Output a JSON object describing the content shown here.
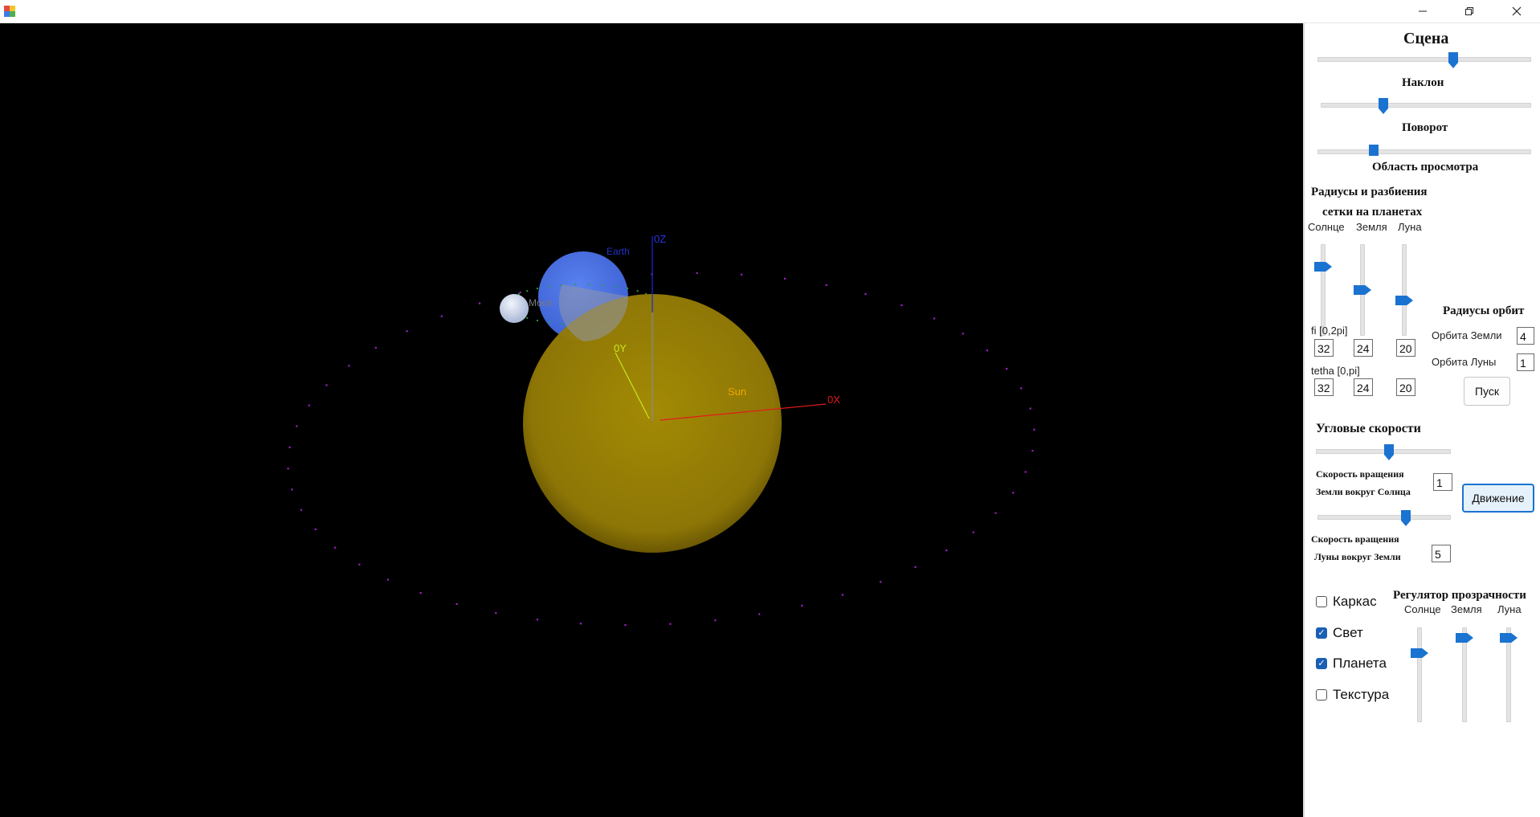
{
  "scene": {
    "labels": {
      "earth": "Earth",
      "moon": "Moon",
      "sun": "Sun",
      "oz": "0Z",
      "oy": "0Y",
      "ox": "0X"
    },
    "colors": {
      "sun": "#a98f07",
      "earth": "#4f74e6",
      "moon": "#c9d4ee",
      "orbit": "#9d1fc0",
      "moon_orbit": "#1fa33c",
      "axis_x": "#e21b1b",
      "axis_y": "#c7e81a",
      "axis_z": "#1c29d8"
    }
  },
  "panel": {
    "scene_title": "Сцена",
    "scene_slider": 0.58,
    "tilt_label": "Наклон",
    "tilt_slider": 0.3,
    "rotation_label": "Поворот",
    "rotation_slider": 0.25,
    "view_area_label": "Область просмотра",
    "radii_title_1": "Радиусы и разбиения",
    "radii_title_2": "сетки на планетах",
    "col_sun": "Солнце",
    "col_earth": "Земля",
    "col_moon": "Луна",
    "radius_sliders": {
      "sun": 0.3,
      "earth": 0.63,
      "moon": 0.8
    },
    "fi_label": "fi [0,2pi]",
    "fi_values": [
      "32",
      "24",
      "20"
    ],
    "tetha_label": "tetha [0,pi]",
    "tetha_values": [
      "32",
      "24",
      "20"
    ],
    "orbit_title": "Радиусы орбит",
    "earth_orbit_label": "Орбита Земли",
    "earth_orbit_value": "4",
    "moon_orbit_label": "Орбита Луны",
    "moon_orbit_value": "1",
    "start_button": "Пуск",
    "angular_title": "Угловые скорости",
    "angular_slider": 0.55,
    "earth_speed_label_1": "Скорость вращения",
    "earth_speed_label_2": "Земли вокруг Солнца",
    "earth_speed_value": "1",
    "move_button": "Движение",
    "earth_speed_slider": 0.66,
    "moon_speed_label_1": "Скорость вращения",
    "moon_speed_label_2": "Луны вокруг Земли",
    "moon_speed_value": "5",
    "checkboxes": [
      {
        "label": "Каркас",
        "checked": false
      },
      {
        "label": "Свет",
        "checked": true
      },
      {
        "label": "Планета",
        "checked": true
      },
      {
        "label": "Текстура",
        "checked": false
      }
    ],
    "transparency_title": "Регулятор прозрачности",
    "transparency_sliders": {
      "sun": 0.4,
      "earth": 0.07,
      "moon": 0.07
    }
  }
}
